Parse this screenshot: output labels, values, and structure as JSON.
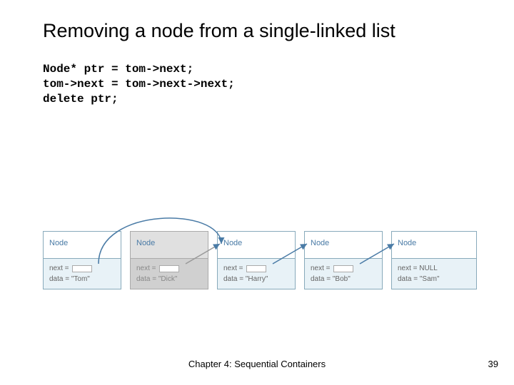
{
  "title": "Removing a node from a single-linked list",
  "code": "Node* ptr = tom->next;\ntom->next = tom->next->next;\ndelete ptr;",
  "nodes": [
    {
      "label": "Node",
      "next": "next =",
      "data": "data = \"Tom\"",
      "deleted": false
    },
    {
      "label": "Node",
      "next": "next =",
      "data": "data = \"Dick\"",
      "deleted": true
    },
    {
      "label": "Node",
      "next": "next =",
      "data": "data = \"Harry\"",
      "deleted": false
    },
    {
      "label": "Node",
      "next": "next =",
      "data": "data = \"Bob\"",
      "deleted": false
    },
    {
      "label": "Node",
      "next": "next = NULL",
      "data": "data = \"Sam\"",
      "deleted": false
    }
  ],
  "footer": {
    "chapter": "Chapter 4: Sequential Containers",
    "page": "39"
  }
}
